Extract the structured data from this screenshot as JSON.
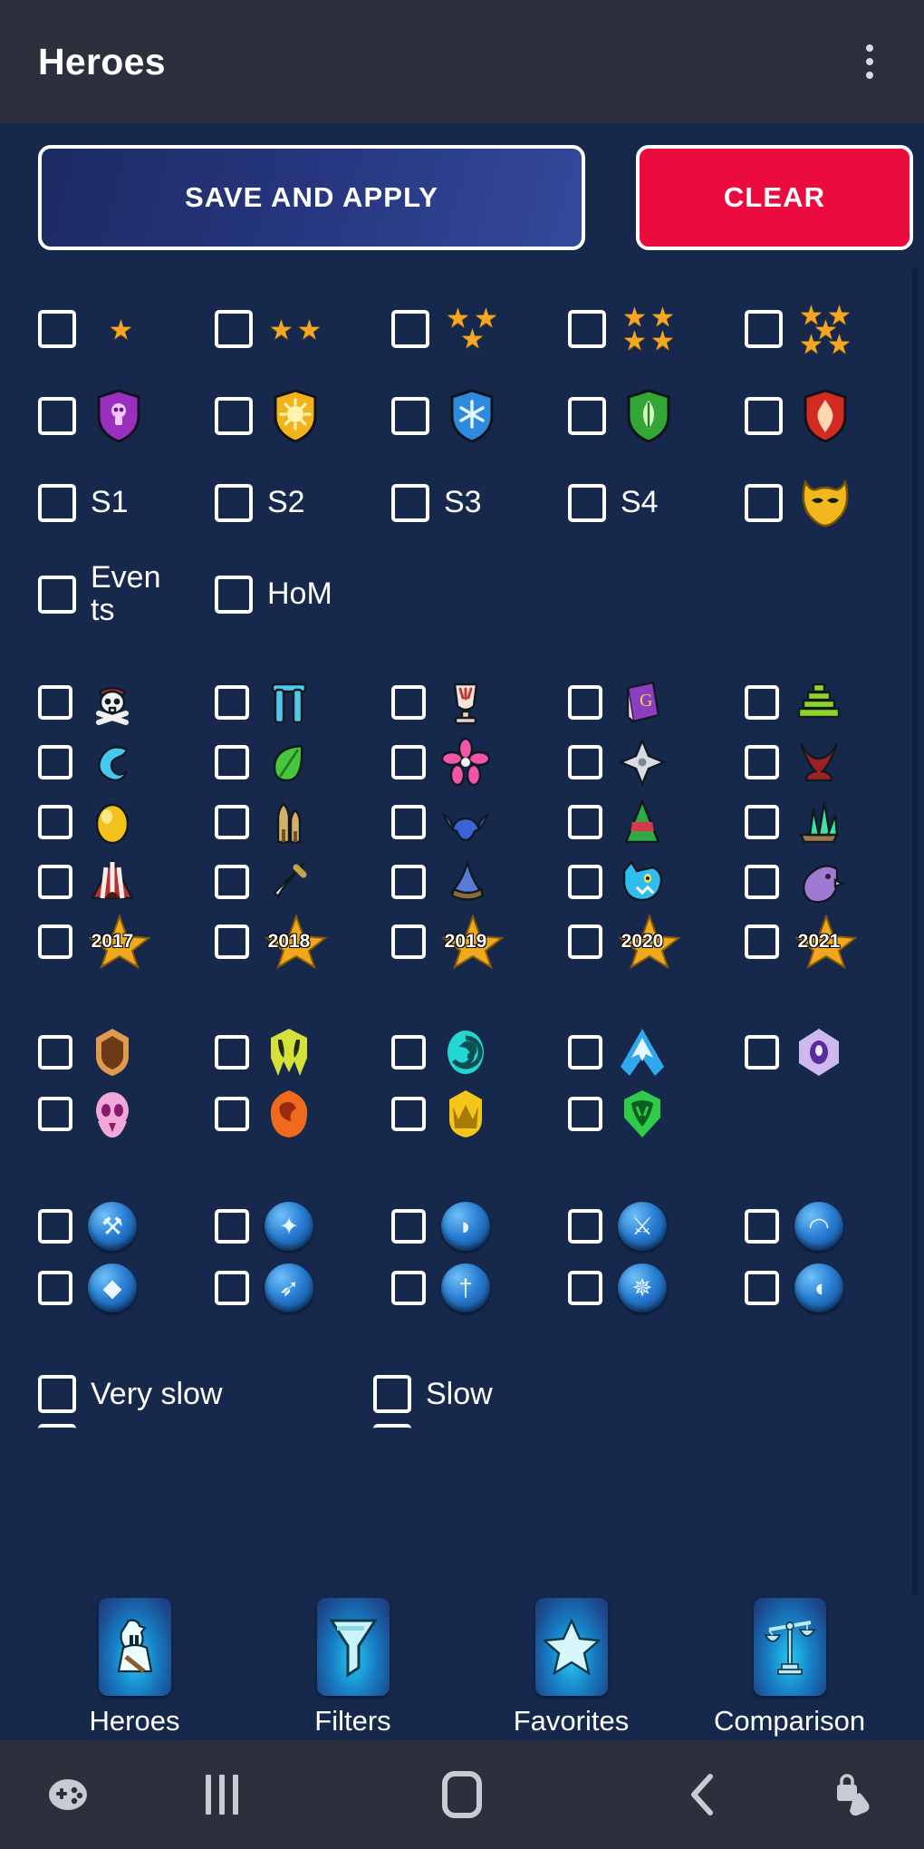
{
  "appbar": {
    "title": "Heroes",
    "overflow_icon": "more-vertical-icon"
  },
  "actions": {
    "save_label": "SAVE AND APPLY",
    "clear_label": "CLEAR",
    "save_color": "#26367e",
    "clear_color": "#ec0b3e"
  },
  "colors": {
    "background": "#16294d",
    "appbar": "#2b303c",
    "accent": "#29c8f0",
    "checkbox_border": "#ffffff"
  },
  "filters": {
    "stars_row": {
      "name": "rarity-stars",
      "items": [
        {
          "icon": "star-1-icon",
          "stars": 1,
          "checked": false
        },
        {
          "icon": "star-2-icon",
          "stars": 2,
          "checked": false
        },
        {
          "icon": "star-3-icon",
          "stars": 3,
          "checked": false
        },
        {
          "icon": "star-4-icon",
          "stars": 4,
          "checked": false
        },
        {
          "icon": "star-5-icon",
          "stars": 5,
          "checked": false
        }
      ]
    },
    "elements_row": {
      "name": "element-shields",
      "items": [
        {
          "icon": "dark-shield-icon",
          "color": "#9a2fbf",
          "checked": false
        },
        {
          "icon": "holy-shield-icon",
          "color": "#f2b21b",
          "checked": false
        },
        {
          "icon": "ice-shield-icon",
          "color": "#2e8bdc",
          "checked": false
        },
        {
          "icon": "nature-shield-icon",
          "color": "#33a636",
          "checked": false
        },
        {
          "icon": "fire-shield-icon",
          "color": "#d12b22",
          "checked": false
        }
      ]
    },
    "seasons_row": {
      "name": "seasons",
      "items": [
        {
          "label": "S1",
          "checked": false
        },
        {
          "label": "S2",
          "checked": false
        },
        {
          "label": "S3",
          "checked": false
        },
        {
          "label": "S4",
          "checked": false
        },
        {
          "label": "",
          "icon": "mask-icon",
          "checked": false
        }
      ]
    },
    "events_row": {
      "name": "events-hom",
      "items": [
        {
          "label": "Events",
          "checked": false
        },
        {
          "label": "HoM",
          "checked": false
        }
      ]
    },
    "families_grid": {
      "name": "hero-families",
      "rows": [
        [
          {
            "icon": "pirate-skull-icon",
            "color": "#e8e8e8",
            "checked": false
          },
          {
            "icon": "stonehenge-icon",
            "color": "#4fc8e8",
            "checked": false
          },
          {
            "icon": "trophy-cup-icon",
            "color": "#f0dcd2",
            "checked": false
          },
          {
            "icon": "purple-book-icon",
            "color": "#8b3fbf",
            "checked": false
          },
          {
            "icon": "green-pyramid-icon",
            "color": "#8fd42a",
            "checked": false
          }
        ],
        [
          {
            "icon": "wave-icon",
            "color": "#45c7f0",
            "checked": false
          },
          {
            "icon": "green-leaf-icon",
            "color": "#46c63c",
            "checked": false
          },
          {
            "icon": "pink-flower-icon",
            "color": "#f256a8",
            "checked": false
          },
          {
            "icon": "shuriken-icon",
            "color": "#d8dde2",
            "checked": false
          },
          {
            "icon": "red-horns-icon",
            "color": "#9b2224",
            "checked": false
          }
        ],
        [
          {
            "icon": "yellow-egg-icon",
            "color": "#f2c21c",
            "checked": false
          },
          {
            "icon": "sand-palace-icon",
            "color": "#d5b06a",
            "checked": false
          },
          {
            "icon": "blue-bat-icon",
            "color": "#3a63d6",
            "checked": false
          },
          {
            "icon": "christmas-tree-icon",
            "color": "#2faa44",
            "checked": false
          },
          {
            "icon": "green-crystal-icon",
            "color": "#3fe0a0",
            "checked": false
          }
        ],
        [
          {
            "icon": "circus-tent-icon",
            "color": "#b52f34",
            "checked": false
          },
          {
            "icon": "sword-icon",
            "color": "#d8dde2",
            "checked": false
          },
          {
            "icon": "wizard-hat-icon",
            "color": "#5a7ad6",
            "checked": false
          },
          {
            "icon": "blue-wolf-icon",
            "color": "#2fbdf0",
            "checked": false
          },
          {
            "icon": "purple-bird-icon",
            "color": "#a07ad0",
            "checked": false
          }
        ],
        [
          {
            "icon": "year-star-icon",
            "label": "2017",
            "checked": false
          },
          {
            "icon": "year-star-icon",
            "label": "2018",
            "checked": false
          },
          {
            "icon": "year-star-icon",
            "label": "2019",
            "checked": false
          },
          {
            "icon": "year-star-icon",
            "label": "2020",
            "checked": false
          },
          {
            "icon": "year-star-icon",
            "label": "2021",
            "checked": false
          }
        ]
      ]
    },
    "emblems_grid": {
      "name": "hero-emblems",
      "rows": [
        [
          {
            "icon": "brown-shield-emblem-icon",
            "color": "#e09a4e",
            "checked": false
          },
          {
            "icon": "yellow-claw-emblem-icon",
            "color": "#d6e03a",
            "checked": false
          },
          {
            "icon": "teal-spiral-emblem-icon",
            "color": "#23d6d0",
            "checked": false
          },
          {
            "icon": "blue-mountain-emblem-icon",
            "color": "#2fa8f0",
            "checked": false
          },
          {
            "icon": "purple-eye-emblem-icon",
            "color": "#cdb8f0",
            "checked": false
          }
        ],
        [
          {
            "icon": "pink-skull-emblem-icon",
            "color": "#f0a8d8",
            "checked": false
          },
          {
            "icon": "orange-rock-emblem-icon",
            "color": "#f06a1e",
            "checked": false
          },
          {
            "icon": "gold-crown-emblem-icon",
            "color": "#f5c518",
            "checked": false
          },
          {
            "icon": "green-mask-emblem-icon",
            "color": "#2fcc4a",
            "checked": false
          }
        ]
      ]
    },
    "classes_grid": {
      "name": "hero-classes",
      "rows": [
        [
          {
            "icon": "barbarian-class-icon",
            "glyph": "⚒",
            "checked": false
          },
          {
            "icon": "paladin-class-icon",
            "glyph": "✦",
            "checked": false
          },
          {
            "icon": "monk-class-icon",
            "glyph": "◗",
            "checked": false
          },
          {
            "icon": "ranger-class-icon",
            "glyph": "⚔",
            "checked": false
          },
          {
            "icon": "fighter-class-icon",
            "glyph": "◠",
            "checked": false
          }
        ],
        [
          {
            "icon": "rogue-class-icon",
            "glyph": "◆",
            "checked": false
          },
          {
            "icon": "druid-class-icon",
            "glyph": "➶",
            "checked": false
          },
          {
            "icon": "sorcerer-class-icon",
            "glyph": "†",
            "checked": false
          },
          {
            "icon": "wizard-class-icon",
            "glyph": "✵",
            "checked": false
          },
          {
            "icon": "cleric-class-icon",
            "glyph": "◖",
            "checked": false
          }
        ]
      ]
    },
    "speed_row": {
      "name": "mana-speed",
      "items": [
        {
          "label": "Very slow",
          "checked": false
        },
        {
          "label": "Slow",
          "checked": false
        }
      ]
    }
  },
  "bottom_nav": {
    "items": [
      {
        "label": "Heroes",
        "icon": "knight-icon",
        "active": true
      },
      {
        "label": "Filters",
        "icon": "funnel-icon",
        "active": false
      },
      {
        "label": "Favorites",
        "icon": "star-icon",
        "active": false
      },
      {
        "label": "Comparison",
        "icon": "scales-icon",
        "active": false
      }
    ]
  },
  "system_nav": {
    "items": [
      {
        "name": "game-launcher-icon"
      },
      {
        "name": "recents-icon"
      },
      {
        "name": "home-icon"
      },
      {
        "name": "back-icon"
      },
      {
        "name": "screen-lock-icon"
      }
    ]
  }
}
